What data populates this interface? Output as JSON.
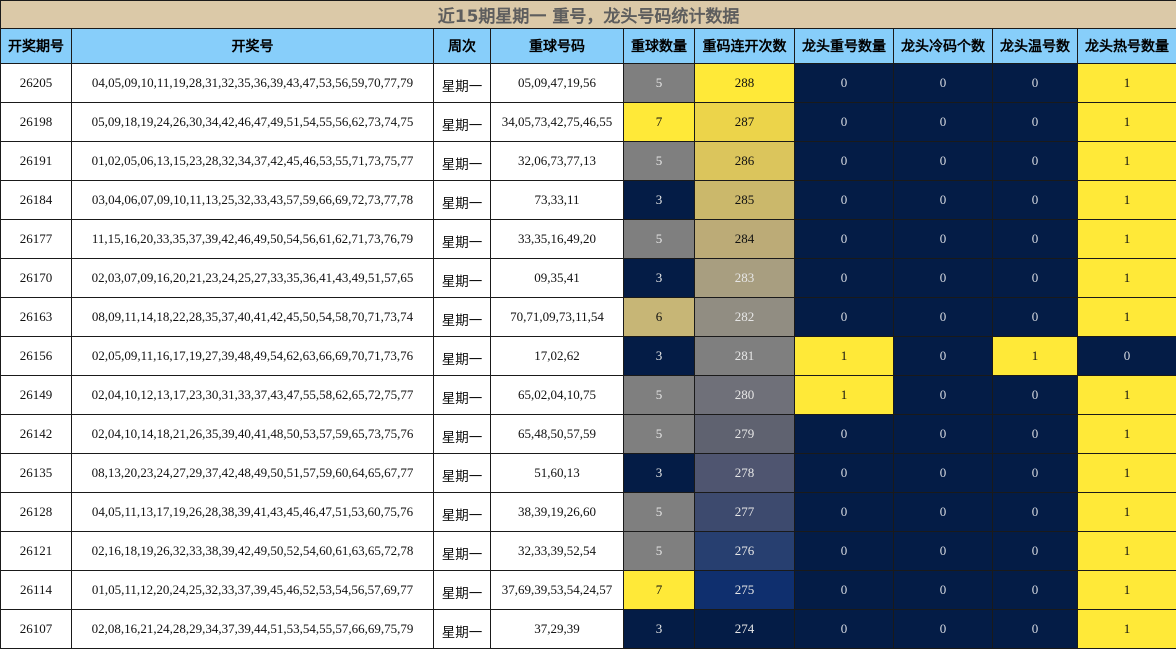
{
  "title": "近15期星期一 重号，龙头号码统计数据",
  "columns": [
    "开奖期号",
    "开奖号",
    "周次",
    "重球号码",
    "重球数量",
    "重码连开次数",
    "龙头重号数量",
    "龙头冷码个数",
    "龙头温号数",
    "龙头热号数量"
  ],
  "colors": {
    "title_bg": "#dbc9a8",
    "header_bg": "#87cefa",
    "dark": "#041c46",
    "yellow": "#ffe938",
    "count_3": "#041c46",
    "count_5": "#7f7f7f",
    "count_6": "#c7b676",
    "count_7": "#ffe938"
  },
  "rows": [
    {
      "period": "26205",
      "numbers": "04,05,09,10,11,19,28,31,32,35,36,39,43,47,53,56,59,70,77,79",
      "weekday": "星期一",
      "repeat_numbers": "05,09,47,19,56",
      "repeat_count": "5",
      "streak": "288",
      "streak_color": "#ffe938",
      "head_repeat": "0",
      "head_cold": "0",
      "head_warm": "0",
      "head_hot": "1"
    },
    {
      "period": "26198",
      "numbers": "05,09,18,19,24,26,30,34,42,46,47,49,51,54,55,56,62,73,74,75",
      "weekday": "星期一",
      "repeat_numbers": "34,05,73,42,75,46,55",
      "repeat_count": "7",
      "streak": "287",
      "streak_color": "#ecd44a",
      "head_repeat": "0",
      "head_cold": "0",
      "head_warm": "0",
      "head_hot": "1"
    },
    {
      "period": "26191",
      "numbers": "01,02,05,06,13,15,23,28,32,34,37,42,45,46,53,55,71,73,75,77",
      "weekday": "星期一",
      "repeat_numbers": "32,06,73,77,13",
      "repeat_count": "5",
      "streak": "286",
      "streak_color": "#dbc55c",
      "head_repeat": "0",
      "head_cold": "0",
      "head_warm": "0",
      "head_hot": "1"
    },
    {
      "period": "26184",
      "numbers": "03,04,06,07,09,10,11,13,25,32,33,43,57,59,66,69,72,73,77,78",
      "weekday": "星期一",
      "repeat_numbers": "73,33,11",
      "repeat_count": "3",
      "streak": "285",
      "streak_color": "#cbb86b",
      "head_repeat": "0",
      "head_cold": "0",
      "head_warm": "0",
      "head_hot": "1"
    },
    {
      "period": "26177",
      "numbers": "11,15,16,20,33,35,37,39,42,46,49,50,54,56,61,62,71,73,76,79",
      "weekday": "星期一",
      "repeat_numbers": "33,35,16,49,20",
      "repeat_count": "5",
      "streak": "284",
      "streak_color": "#bcab77",
      "head_repeat": "0",
      "head_cold": "0",
      "head_warm": "0",
      "head_hot": "1"
    },
    {
      "period": "26170",
      "numbers": "02,03,07,09,16,20,21,23,24,25,27,33,35,36,41,43,49,51,57,65",
      "weekday": "星期一",
      "repeat_numbers": "09,35,41",
      "repeat_count": "3",
      "streak": "283",
      "streak_color": "#a89e80",
      "head_repeat": "0",
      "head_cold": "0",
      "head_warm": "0",
      "head_hot": "1"
    },
    {
      "period": "26163",
      "numbers": "08,09,11,14,18,22,28,35,37,40,41,42,45,50,54,58,70,71,73,74",
      "weekday": "星期一",
      "repeat_numbers": "70,71,09,73,11,54",
      "repeat_count": "6",
      "streak": "282",
      "streak_color": "#918d82",
      "head_repeat": "0",
      "head_cold": "0",
      "head_warm": "0",
      "head_hot": "1"
    },
    {
      "period": "26156",
      "numbers": "02,05,09,11,16,17,19,27,39,48,49,54,62,63,66,69,70,71,73,76",
      "weekday": "星期一",
      "repeat_numbers": "17,02,62",
      "repeat_count": "3",
      "streak": "281",
      "streak_color": "#7f7f7f",
      "head_repeat": "1",
      "head_cold": "0",
      "head_warm": "1",
      "head_hot": "0"
    },
    {
      "period": "26149",
      "numbers": "02,04,10,12,13,17,23,30,31,33,37,43,47,55,58,62,65,72,75,77",
      "weekday": "星期一",
      "repeat_numbers": "65,02,04,10,75",
      "repeat_count": "5",
      "streak": "280",
      "streak_color": "#6f7079",
      "head_repeat": "1",
      "head_cold": "0",
      "head_warm": "0",
      "head_hot": "1"
    },
    {
      "period": "26142",
      "numbers": "02,04,10,14,18,21,26,35,39,40,41,48,50,53,57,59,65,73,75,76",
      "weekday": "星期一",
      "repeat_numbers": "65,48,50,57,59",
      "repeat_count": "5",
      "streak": "279",
      "streak_color": "#5f6270",
      "head_repeat": "0",
      "head_cold": "0",
      "head_warm": "0",
      "head_hot": "1"
    },
    {
      "period": "26135",
      "numbers": "08,13,20,23,24,27,29,37,42,48,49,50,51,57,59,60,64,65,67,77",
      "weekday": "星期一",
      "repeat_numbers": "51,60,13",
      "repeat_count": "3",
      "streak": "278",
      "streak_color": "#4f5570",
      "head_repeat": "0",
      "head_cold": "0",
      "head_warm": "0",
      "head_hot": "1"
    },
    {
      "period": "26128",
      "numbers": "04,05,11,13,17,19,26,28,38,39,41,43,45,46,47,51,53,60,75,76",
      "weekday": "星期一",
      "repeat_numbers": "38,39,19,26,60",
      "repeat_count": "5",
      "streak": "277",
      "streak_color": "#3d4a6e",
      "head_repeat": "0",
      "head_cold": "0",
      "head_warm": "0",
      "head_hot": "1"
    },
    {
      "period": "26121",
      "numbers": "02,16,18,19,26,32,33,38,39,42,49,50,52,54,60,61,63,65,72,78",
      "weekday": "星期一",
      "repeat_numbers": "32,33,39,52,54",
      "repeat_count": "5",
      "streak": "276",
      "streak_color": "#273f70",
      "head_repeat": "0",
      "head_cold": "0",
      "head_warm": "0",
      "head_hot": "1"
    },
    {
      "period": "26114",
      "numbers": "01,05,11,12,20,24,25,32,33,37,39,45,46,52,53,54,56,57,69,77",
      "weekday": "星期一",
      "repeat_numbers": "37,69,39,53,54,24,57",
      "repeat_count": "7",
      "streak": "275",
      "streak_color": "#0f2f6e",
      "head_repeat": "0",
      "head_cold": "0",
      "head_warm": "0",
      "head_hot": "1"
    },
    {
      "period": "26107",
      "numbers": "02,08,16,21,24,28,29,34,37,39,44,51,53,54,55,57,66,69,75,79",
      "weekday": "星期一",
      "repeat_numbers": "37,29,39",
      "repeat_count": "3",
      "streak": "274",
      "streak_color": "#041c46",
      "head_repeat": "0",
      "head_cold": "0",
      "head_warm": "0",
      "head_hot": "1"
    }
  ]
}
